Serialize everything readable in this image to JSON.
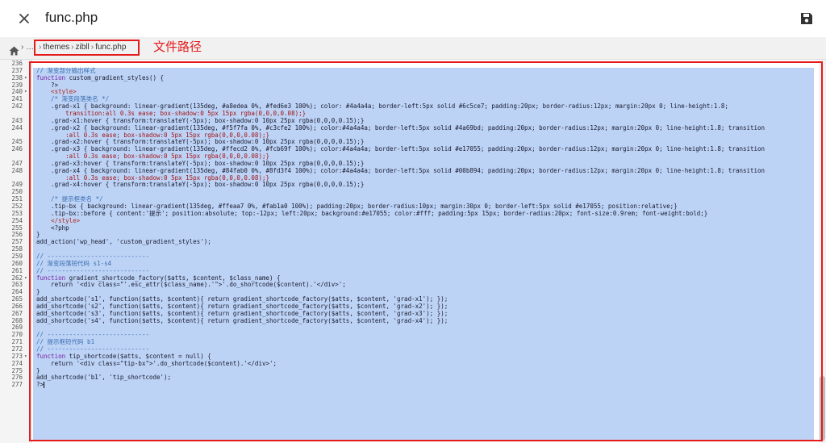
{
  "titlebar": {
    "close_icon": "close-icon",
    "title": "func.php",
    "save_icon": "save-icon"
  },
  "breadcrumb": {
    "home_icon": "home-icon",
    "lead": "› …",
    "items": [
      "themes",
      "zibll",
      "func.php"
    ],
    "separator": "›",
    "annotation_label": "文件路径"
  },
  "colors": {
    "selection": "#bcd3f6",
    "annotation": "#e51a1a"
  },
  "editor": {
    "lines": [
      {
        "n": "236",
        "fold": false,
        "text": ""
      },
      {
        "n": "237",
        "fold": false,
        "text": "// 渐变部分输出样式"
      },
      {
        "n": "238",
        "fold": true,
        "text": "function custom_gradient_styles() {"
      },
      {
        "n": "239",
        "fold": false,
        "text": "    ?>"
      },
      {
        "n": "240",
        "fold": true,
        "text": "    <style>"
      },
      {
        "n": "241",
        "fold": false,
        "text": "    /* 渐变段落类名 */"
      },
      {
        "n": "242",
        "fold": false,
        "text": "    .grad-x1 { background: linear-gradient(135deg, #a8edea 0%, #fed6e3 100%); color: #4a4a4a; border-left:5px solid #6c5ce7; padding:20px; border-radius:12px; margin:20px 0; line-height:1.8;"
      },
      {
        "n": "",
        "fold": false,
        "text": "        transition:all 0.3s ease; box-shadow:0 5px 15px rgba(0,0,0,0.08);}",
        "cont": true
      },
      {
        "n": "243",
        "fold": false,
        "text": "    .grad-x1:hover { transform:translateY(-5px); box-shadow:0 10px 25px rgba(0,0,0,0.15);}"
      },
      {
        "n": "244",
        "fold": false,
        "text": "    .grad-x2 { background: linear-gradient(135deg, #f5f7fa 0%, #c3cfe2 100%); color:#4a4a4a; border-left:5px solid #4a69bd; padding:20px; border-radius:12px; margin:20px 0; line-height:1.8; transition"
      },
      {
        "n": "",
        "fold": false,
        "text": "        :all 0.3s ease; box-shadow:0 5px 15px rgba(0,0,0,0.08);}",
        "cont": true
      },
      {
        "n": "245",
        "fold": false,
        "text": "    .grad-x2:hover { transform:translateY(-5px); box-shadow:0 10px 25px rgba(0,0,0,0.15);}"
      },
      {
        "n": "246",
        "fold": false,
        "text": "    .grad-x3 { background: linear-gradient(135deg, #ffecd2 0%, #fcb69f 100%); color:#4a4a4a; border-left:5px solid #e17055; padding:20px; border-radius:12px; margin:20px 0; line-height:1.8; transition"
      },
      {
        "n": "",
        "fold": false,
        "text": "        :all 0.3s ease; box-shadow:0 5px 15px rgba(0,0,0,0.08);}",
        "cont": true
      },
      {
        "n": "247",
        "fold": false,
        "text": "    .grad-x3:hover { transform:translateY(-5px); box-shadow:0 10px 25px rgba(0,0,0,0.15);}"
      },
      {
        "n": "248",
        "fold": false,
        "text": "    .grad-x4 { background: linear-gradient(135deg, #84fab0 0%, #8fd3f4 100%); color:#4a4a4a; border-left:5px solid #00b894; padding:20px; border-radius:12px; margin:20px 0; line-height:1.8; transition"
      },
      {
        "n": "",
        "fold": false,
        "text": "        :all 0.3s ease; box-shadow:0 5px 15px rgba(0,0,0,0.08);}",
        "cont": true
      },
      {
        "n": "249",
        "fold": false,
        "text": "    .grad-x4:hover { transform:translateY(-5px); box-shadow:0 10px 25px rgba(0,0,0,0.15);}"
      },
      {
        "n": "250",
        "fold": false,
        "text": ""
      },
      {
        "n": "251",
        "fold": false,
        "text": "    /* 提示框类名 */"
      },
      {
        "n": "252",
        "fold": false,
        "text": "    .tip-bx { background: linear-gradient(135deg, #ffeaa7 0%, #fab1a0 100%); padding:20px; border-radius:10px; margin:30px 0; border-left:5px solid #e17055; position:relative;}"
      },
      {
        "n": "253",
        "fold": false,
        "text": "    .tip-bx::before { content:'提示'; position:absolute; top:-12px; left:20px; background:#e17055; color:#fff; padding:5px 15px; border-radius:20px; font-size:0.9rem; font-weight:bold;}"
      },
      {
        "n": "254",
        "fold": false,
        "text": "    </style>"
      },
      {
        "n": "255",
        "fold": false,
        "text": "    <?php"
      },
      {
        "n": "256",
        "fold": false,
        "text": "}"
      },
      {
        "n": "257",
        "fold": false,
        "text": "add_action('wp_head', 'custom_gradient_styles');"
      },
      {
        "n": "258",
        "fold": false,
        "text": ""
      },
      {
        "n": "259",
        "fold": false,
        "text": "// ----------------------------"
      },
      {
        "n": "260",
        "fold": false,
        "text": "// 渐变段落短代码 s1-s4"
      },
      {
        "n": "261",
        "fold": false,
        "text": "// ----------------------------"
      },
      {
        "n": "262",
        "fold": true,
        "text": "function gradient_shortcode_factory($atts, $content, $class_name) {"
      },
      {
        "n": "263",
        "fold": false,
        "text": "    return '<div class=\"'.esc_attr($class_name).'\">'.do_shortcode($content).'</div>';"
      },
      {
        "n": "264",
        "fold": false,
        "text": "}"
      },
      {
        "n": "265",
        "fold": false,
        "text": "add_shortcode('s1', function($atts, $content){ return gradient_shortcode_factory($atts, $content, 'grad-x1'); });"
      },
      {
        "n": "266",
        "fold": false,
        "text": "add_shortcode('s2', function($atts, $content){ return gradient_shortcode_factory($atts, $content, 'grad-x2'); });"
      },
      {
        "n": "267",
        "fold": false,
        "text": "add_shortcode('s3', function($atts, $content){ return gradient_shortcode_factory($atts, $content, 'grad-x3'); });"
      },
      {
        "n": "268",
        "fold": false,
        "text": "add_shortcode('s4', function($atts, $content){ return gradient_shortcode_factory($atts, $content, 'grad-x4'); });"
      },
      {
        "n": "269",
        "fold": false,
        "text": ""
      },
      {
        "n": "270",
        "fold": false,
        "text": "// ----------------------------"
      },
      {
        "n": "271",
        "fold": false,
        "text": "// 提示框短代码 b1"
      },
      {
        "n": "272",
        "fold": false,
        "text": "// ----------------------------"
      },
      {
        "n": "273",
        "fold": true,
        "text": "function tip_shortcode($atts, $content = null) {"
      },
      {
        "n": "274",
        "fold": false,
        "text": "    return '<div class=\"tip-bx\">'.do_shortcode($content).'</div>';"
      },
      {
        "n": "275",
        "fold": false,
        "text": "}"
      },
      {
        "n": "276",
        "fold": false,
        "text": "add_shortcode('b1', 'tip_shortcode');"
      },
      {
        "n": "277",
        "fold": false,
        "text": "?>"
      }
    ]
  }
}
